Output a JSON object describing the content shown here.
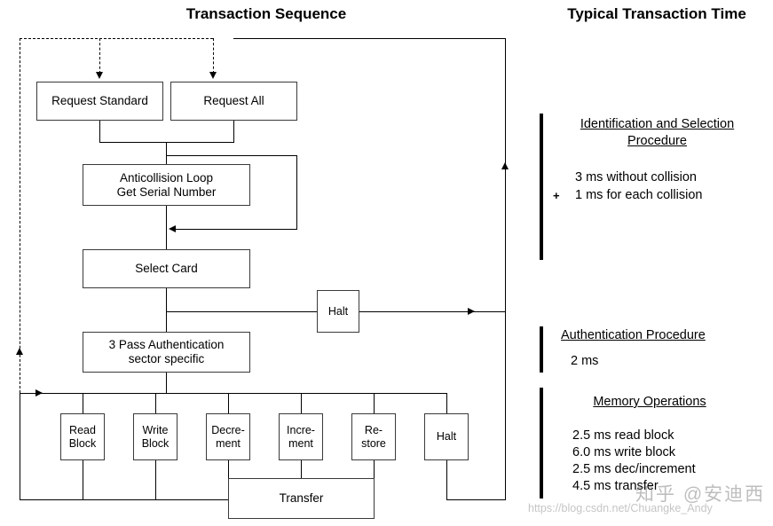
{
  "headings": {
    "flow_title": "Transaction Sequence",
    "time_title": "Typical Transaction Time"
  },
  "flow": {
    "boxes": {
      "request_standard": "Request Standard",
      "request_all": "Request All",
      "anticollision_line1": "Anticollision Loop",
      "anticollision_line2": "Get Serial Number",
      "select_card": "Select Card",
      "halt_mid": "Halt",
      "auth_line1": "3 Pass Authentication",
      "auth_line2": "sector specific",
      "read_block_l1": "Read",
      "read_block_l2": "Block",
      "write_block_l1": "Write",
      "write_block_l2": "Block",
      "decrement_l1": "Decre-",
      "decrement_l2": "ment",
      "increment_l1": "Incre-",
      "increment_l2": "ment",
      "restore_l1": "Re-",
      "restore_l2": "store",
      "halt_bottom": "Halt",
      "transfer": "Transfer"
    }
  },
  "timing": {
    "sections": [
      {
        "heading_line1": "Identification and Selection",
        "heading_line2": "Procedure",
        "rows": [
          {
            "prefix": "",
            "text": "3 ms without collision"
          },
          {
            "prefix": "+",
            "text": "1 ms for each collision"
          }
        ]
      },
      {
        "heading_line1": "Authentication Procedure",
        "heading_line2": "",
        "rows": [
          {
            "prefix": "",
            "text": "2 ms"
          }
        ]
      },
      {
        "heading_line1": "Memory Operations",
        "heading_line2": "",
        "rows": [
          {
            "prefix": "",
            "text": "2.5 ms read block"
          },
          {
            "prefix": "",
            "text": "6.0 ms write block"
          },
          {
            "prefix": "",
            "text": "2.5 ms dec/increment"
          },
          {
            "prefix": "",
            "text": "4.5 ms transfer"
          }
        ]
      }
    ]
  },
  "watermarks": {
    "chinese": "知乎 @安迪西",
    "url": "https://blog.csdn.net/Chuangke_Andy"
  }
}
